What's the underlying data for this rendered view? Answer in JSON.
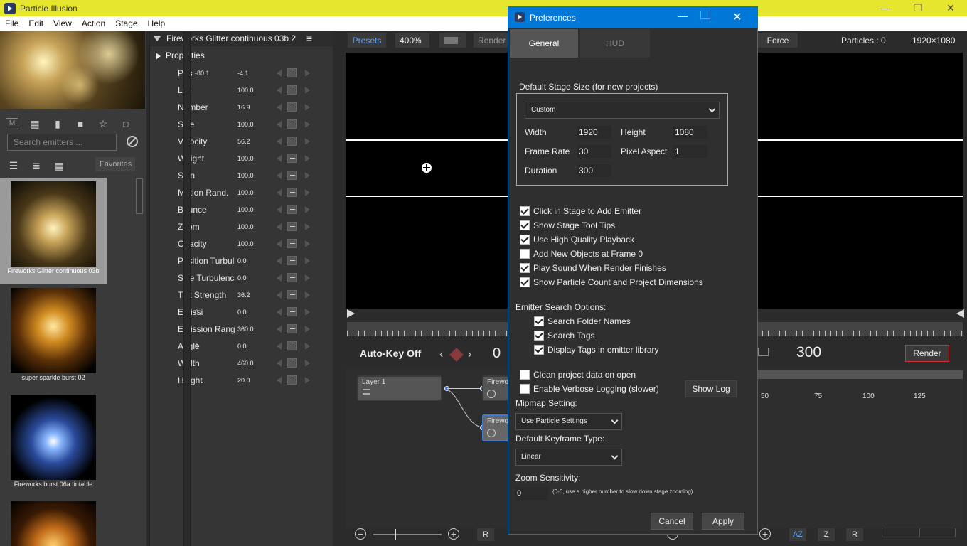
{
  "app": {
    "title": "Particle Illusion",
    "menu": [
      "File",
      "Edit",
      "View",
      "Action",
      "Stage",
      "Help"
    ],
    "window_controls": [
      "—",
      "❐",
      "✕"
    ]
  },
  "library": {
    "search_placeholder": "Search emitters ...",
    "m_label": "M",
    "favorites_label": "Favorites",
    "items": [
      {
        "caption": "Fireworks Glitter continuous 03b",
        "selected": true
      },
      {
        "caption": "super sparkle burst 02",
        "selected": false
      },
      {
        "caption": "Fireworks burst 06a tintable",
        "selected": false
      },
      {
        "caption": "",
        "selected": false
      }
    ]
  },
  "properties": {
    "emitter_title": "Fireworks Glitter continuous 03b 2",
    "section_label": "Properties",
    "menu_glyph": "≡",
    "rows": [
      {
        "name": "Pos",
        "value": "-4.1",
        "value_alt": "-80.1"
      },
      {
        "name": "Life",
        "value": "100.0"
      },
      {
        "name": "Number",
        "value": "16.9"
      },
      {
        "name": "Size",
        "value": "100.0"
      },
      {
        "name": "Velocity",
        "value": "56.2"
      },
      {
        "name": "Weight",
        "value": "100.0"
      },
      {
        "name": "Spin",
        "value": "100.0"
      },
      {
        "name": "Motion Rand.",
        "value": "100.0"
      },
      {
        "name": "Bounce",
        "value": "100.0"
      },
      {
        "name": "Zoom",
        "value": "100.0"
      },
      {
        "name": "Opacity",
        "value": "100.0"
      },
      {
        "name": "Position Turbul",
        "value": "0.0"
      },
      {
        "name": "Size Turbulenc",
        "value": "0.0"
      },
      {
        "name": "Tint Strength",
        "value": "36.2"
      },
      {
        "name": "Emissi",
        "value": "0.0",
        "value_alt": "0"
      },
      {
        "name": "Emission Rang",
        "value": "360.0"
      },
      {
        "name": "Angle",
        "value": "0.0",
        "value_alt": "0"
      },
      {
        "name": "Width",
        "value": "460.0"
      },
      {
        "name": "Height",
        "value": "20.0"
      }
    ]
  },
  "stage": {
    "presets_label": "Presets",
    "zoom": "400%",
    "render_view_label": "Render V",
    "force_label": "Force",
    "particles": "Particles : 0",
    "dimensions": "1920×1080",
    "autokey_label": "Auto-Key Off",
    "current_frame": "0",
    "end_frame": "300",
    "render_label": "Render",
    "timeline_ticks": [
      "50",
      "75",
      "100",
      "125"
    ],
    "nodes": {
      "layer_label": "Layer 1",
      "fw1_label": "Firewo",
      "fw2_label": "Firewo"
    },
    "bottom": {
      "minus": "−",
      "plus": "+",
      "r_label": "R",
      "az_label": "AZ",
      "z_label": "Z",
      "r2_label": "R"
    }
  },
  "prefs": {
    "title": "Preferences",
    "tabs": [
      "General",
      "HUD"
    ],
    "stage_size_label": "Default Stage Size (for new projects)",
    "stage_preset": "Custom",
    "width_label": "Width",
    "width": "1920",
    "height_label": "Height",
    "height": "1080",
    "frame_rate_label": "Frame Rate",
    "frame_rate": "30",
    "pixel_aspect_label": "Pixel Aspect",
    "pixel_aspect": "1",
    "duration_label": "Duration",
    "duration": "300",
    "checks": [
      {
        "label": "Click in Stage to Add Emitter",
        "checked": true
      },
      {
        "label": "Show Stage Tool Tips",
        "checked": true
      },
      {
        "label": "Use High Quality Playback",
        "checked": true
      },
      {
        "label": "Add New Objects at Frame 0",
        "checked": false
      },
      {
        "label": "Play Sound When Render Finishes",
        "checked": true
      },
      {
        "label": "Show Particle Count and Project Dimensions",
        "checked": true
      }
    ],
    "search_options_label": "Emitter Search Options:",
    "search_checks": [
      {
        "label": "Search Folder Names",
        "checked": true
      },
      {
        "label": "Search Tags",
        "checked": true
      },
      {
        "label": "Display Tags in emitter library",
        "checked": true
      }
    ],
    "clean_label": "Clean project data on open",
    "verbose_label": "Enable Verbose Logging (slower)",
    "show_log_label": "Show Log",
    "mipmap_label": "Mipmap Setting:",
    "mipmap_value": "Use Particle Settings",
    "keyframe_label": "Default Keyframe Type:",
    "keyframe_value": "Linear",
    "zoom_sens_label": "Zoom Sensitivity:",
    "zoom_sens_value": "0",
    "zoom_sens_hint": "(0-6, use a higher number to slow down stage zooming)",
    "cancel_label": "Cancel",
    "apply_label": "Apply"
  }
}
